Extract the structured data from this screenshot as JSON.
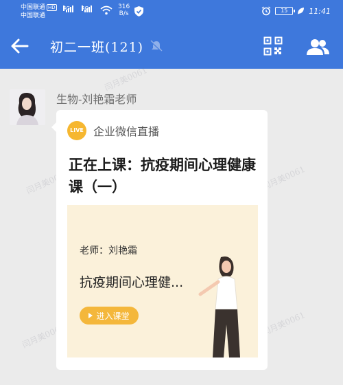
{
  "status_bar": {
    "carrier_1": "中国联通",
    "hd_badge": "HD",
    "carrier_2": "中国联通",
    "network_1": "4G",
    "network_2": "4G",
    "speed_value": "316",
    "speed_unit": "B/s",
    "battery": "15",
    "time": "11:41"
  },
  "header": {
    "title": "初二一班(121)"
  },
  "chat": {
    "sender": "生物-刘艳霜老师",
    "card": {
      "badge": "LIVE",
      "source": "企业微信直播",
      "headline": "正在上课：抗疫期间心理健康课（一）",
      "cover": {
        "teacher": "老师：刘艳霜",
        "course": "抗疫期间心理健...",
        "enter_label": "进入课堂"
      }
    }
  },
  "watermarks": [
    "闫月美0061",
    "闫月美0061",
    "闫月美0061",
    "闫月美0061",
    "闫月美0061"
  ],
  "colors": {
    "header_bg": "#3e78dc",
    "chat_bg": "#ebebeb",
    "live_badge": "#f6b730",
    "cover_bg": "#fbf1da",
    "enter_button": "#f4b73b"
  },
  "icons": [
    "back-arrow-icon",
    "mute-bell-icon",
    "qr-code-icon",
    "group-members-icon",
    "wifi-icon",
    "shield-check-icon",
    "alarm-clock-icon",
    "battery-icon",
    "leaf-icon",
    "play-icon"
  ]
}
